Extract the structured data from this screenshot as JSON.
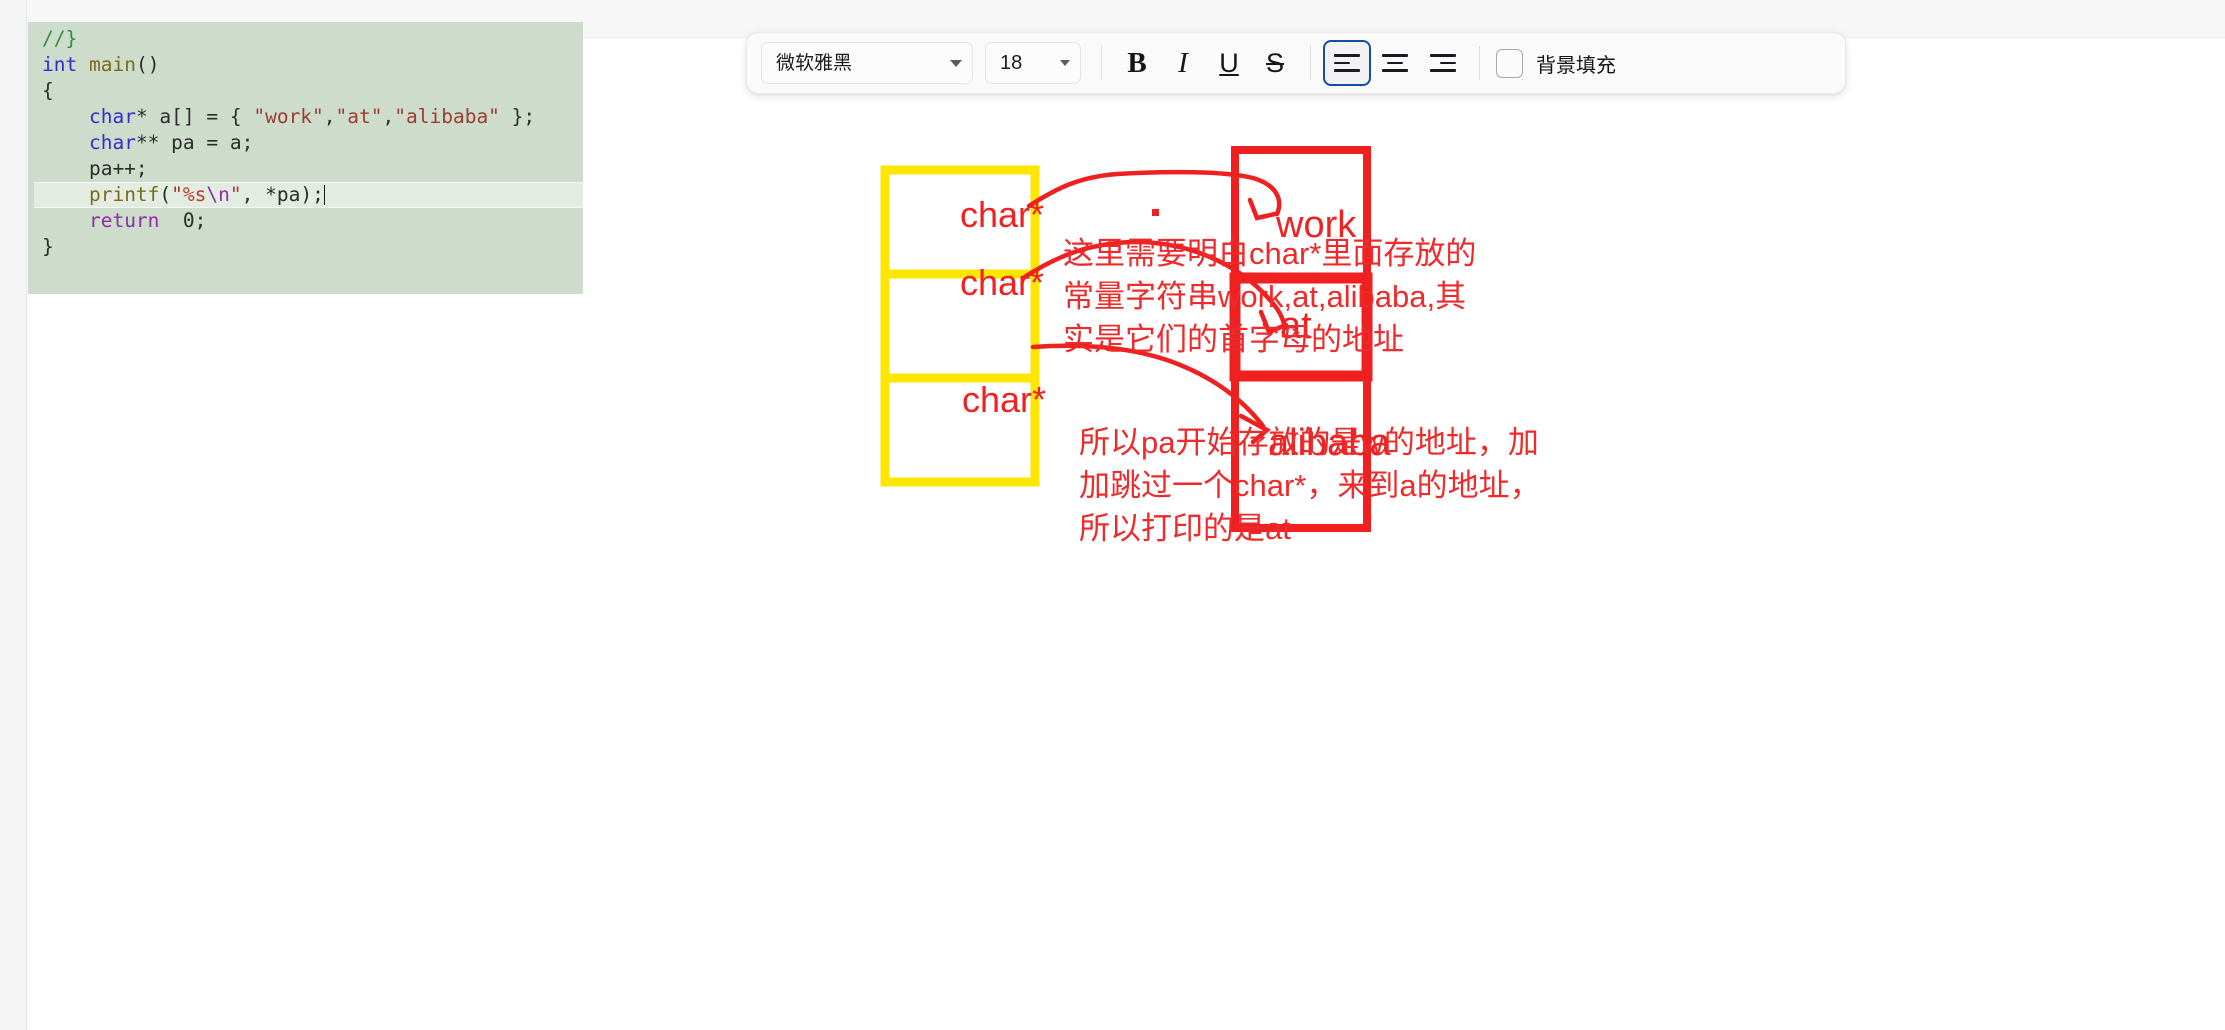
{
  "toolbar": {
    "font_family_value": "微软雅黑",
    "font_size_value": "18",
    "bold_label": "B",
    "italic_label": "I",
    "underline_label": "U",
    "strikethrough_label": "S",
    "align_left_label": "",
    "align_center_label": "",
    "align_right_label": "",
    "background_fill_label": "背景填充",
    "background_fill_checked": false,
    "active_alignment": "left",
    "accent_color": "#12509b"
  },
  "code": {
    "language": "c",
    "lines": [
      "//}",
      "int main()",
      "{",
      "    char* a[] = { \"work\",\"at\",\"alibaba\" };",
      "    char** pa = a;",
      "    pa++;",
      "    printf(\"%s\\n\", *pa);",
      "    return  0;",
      "}"
    ],
    "highlighted_line": "    printf(\"%s\\n\", *pa);",
    "background_color": "#cddccb"
  },
  "diagram": {
    "pointer_array": {
      "border_color": "#ffe600",
      "cells": [
        "char*",
        "char*",
        "char*"
      ]
    },
    "string_literals": {
      "border_color": "#ee2020",
      "cells": [
        "work",
        "at",
        "alibaba"
      ]
    },
    "arrow_color": "#ee2020",
    "label_color": "#ee2222",
    "connections": [
      {
        "from": "char* [0]",
        "to": "work"
      },
      {
        "from": "char* [1]",
        "to": "at"
      },
      {
        "from": "char* [2]",
        "to": "alibaba"
      }
    ]
  },
  "annotations": [
    {
      "id": "note-char-pointer-contents",
      "text": "这里需要明白char*里面存放的\n常量字符串work,at,alibaba,其\n实是它们的首字母的地址",
      "color": "#ee2a2a"
    },
    {
      "id": "note-pa-increment",
      "text": "所以pa开始存放的是w的地址，加\n加跳过一个char*，来到a的地址，\n所以打印的是at",
      "color": "#ee2a2a"
    }
  ]
}
